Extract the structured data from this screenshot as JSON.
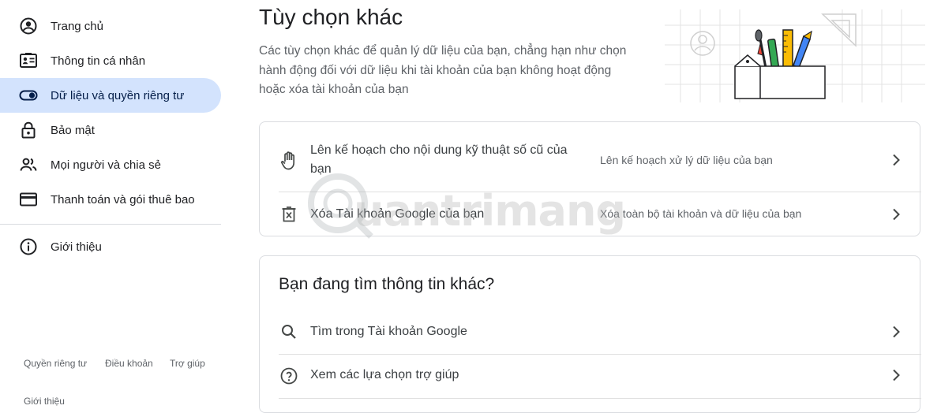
{
  "sidebar": {
    "items": [
      {
        "label": "Trang chủ",
        "icon": "account-circle-icon"
      },
      {
        "label": "Thông tin cá nhân",
        "icon": "id-card-icon"
      },
      {
        "label": "Dữ liệu và quyền riêng tư",
        "icon": "toggle-icon",
        "active": true
      },
      {
        "label": "Bảo mật",
        "icon": "lock-icon"
      },
      {
        "label": "Mọi người và chia sẻ",
        "icon": "people-icon"
      },
      {
        "label": "Thanh toán và gói thuê bao",
        "icon": "credit-card-icon"
      },
      {
        "label": "Giới thiệu",
        "icon": "info-icon"
      }
    ],
    "footer": {
      "privacy": "Quyền riêng tư",
      "terms": "Điều khoản",
      "help": "Trợ giúp",
      "about": "Giới thiệu"
    }
  },
  "main": {
    "title": "Tùy chọn khác",
    "description": "Các tùy chọn khác để quản lý dữ liệu của bạn, chẳng hạn như chọn hành động đối với dữ liệu khi tài khoản của bạn không hoạt động hoặc xóa tài khoản của bạn",
    "options": [
      {
        "title": "Lên kế hoạch cho nội dung kỹ thuật số cũ của bạn",
        "subtitle": "Lên kế hoạch xử lý dữ liệu của bạn",
        "icon": "hand-icon"
      },
      {
        "title": "Xóa Tài khoản Google của bạn",
        "subtitle": "Xóa toàn bộ tài khoản và dữ liệu của bạn",
        "icon": "delete-icon"
      }
    ],
    "more_info": {
      "title": "Bạn đang tìm thông tin khác?",
      "items": [
        {
          "label": "Tìm trong Tài khoản Google",
          "icon": "search-icon"
        },
        {
          "label": "Xem các lựa chọn trợ giúp",
          "icon": "help-icon"
        }
      ]
    }
  },
  "watermark": "uantrimang",
  "colors": {
    "active_bg": "#d3e3fd",
    "border": "#dadce0",
    "text_secondary": "#5f6368"
  }
}
